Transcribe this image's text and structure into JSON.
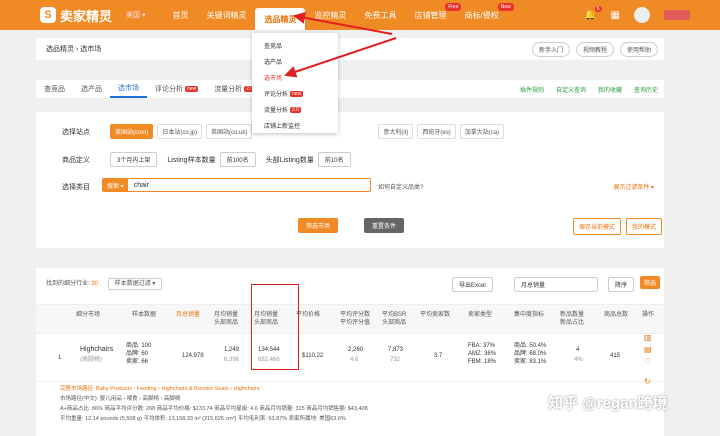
{
  "brand": "卖家精灵",
  "site_selector": "美国 ▾",
  "nav": [
    {
      "label": "首页"
    },
    {
      "label": "关键词精灵"
    },
    {
      "label": "选品精灵"
    },
    {
      "label": "监控精灵"
    },
    {
      "label": "免费工具"
    },
    {
      "label": "店铺管理",
      "badge": "Free"
    },
    {
      "label": "商标/侵权",
      "badge": "New"
    }
  ],
  "notif_count": "6",
  "breadcrumb": "选品精灵 › 选市场",
  "crumb_buttons": [
    "新手入门",
    "视频教程",
    "使用帮助"
  ],
  "dropdown": [
    {
      "label": "查竞品"
    },
    {
      "label": "选产品"
    },
    {
      "label": "选市场"
    },
    {
      "label": "评论分析",
      "badge": "new"
    },
    {
      "label": "流量分析",
      "badge": "2.0"
    },
    {
      "label": "店铺上新监控"
    }
  ],
  "tabs": [
    {
      "label": "查竞品"
    },
    {
      "label": "选产品"
    },
    {
      "label": "选市场"
    },
    {
      "label": "评论分析",
      "badge": "new"
    },
    {
      "label": "流量分析",
      "badge": "2.0"
    }
  ],
  "tab_links": [
    "插件规则",
    "自定义查询",
    "我的收藏",
    "查询历史"
  ],
  "filters": {
    "site_label": "选择站点",
    "sites": [
      "美国站(com)",
      "日本站(co.jp)",
      "英国站(co.uk)",
      "意大利(it)",
      "西班牙(es)",
      "加拿大站(ca)"
    ],
    "def_label": "商品定义",
    "period": "3个月内上架",
    "listing_label": "Listing样本数量",
    "listing_val": "前100名",
    "head_label": "头部Listing数量",
    "head_val": "前10名",
    "category_label": "选择类目",
    "search_prefix": "搜索 ▾",
    "search_value": "chair",
    "hint": "如何自定义品类?",
    "more": "展示过滤条件 ▾",
    "search_btn": "筛选市场",
    "reset_btn": "重置条件",
    "save_btn": "保存当前模式",
    "my_mode_btn": "我的模式"
  },
  "results": {
    "prefix": "找到的细分行业:",
    "count": "30",
    "sample": "样本数据过滤 ▾",
    "export": "导出Excel",
    "sort": "月总销量",
    "order": "降序",
    "filter_btn": "筛选"
  },
  "columns": [
    "细分市场",
    "样本数据",
    "月总销量",
    "月均销量\n头部商品",
    "月均销量\n头部商品",
    "平均价格",
    "平均评分数\n平均评分值",
    "平均BSR\n头部商品",
    "平均卖家数",
    "卖家类型",
    "集中度指标",
    "新品数量\n新品占比",
    "商品总数",
    "操作"
  ],
  "row": {
    "idx": "1",
    "name": "Highchairs",
    "name_cn": "(高脚椅)",
    "sample": "商品: 100\n品牌: 60\n卖家: 66",
    "monthly_total": "124,978",
    "avg_units": "1,249",
    "avg_units_sub": "6,396",
    "avg_rev": "134,544",
    "avg_rev_sub": "682,466",
    "avg_price": "$110.22",
    "ratings": "2,260",
    "ratings_sub": "4.6",
    "bsr": "7,873",
    "bsr_sub": "732",
    "sellers": "3.7",
    "seller_types": "FBA: 37%\nAMZ: 36%\nFBM: 18%",
    "concentration": "商品: 50.4%\n品牌: 68.0%\n卖家: 83.1%",
    "new_count": "4",
    "new_pct": "4%",
    "total": "415"
  },
  "detail_lines": [
    "完整市场路径: Baby Products › Feeding › Highchairs & Booster Seats › Highchairs",
    "市场路径(中文): 婴儿用品 › 喂食 › 高脚椅 › 高脚椅",
    "A+商品占比: 86%   商品平均评分数: 268   商品平均价格: $133.74   商品平均星级: 4.6   商品月均销量: 315   商品月均销售额: $43,408",
    "平均重量: 12.14 pounds (5,508 g)   平均体积: 13,158.33 in³ (215,626 cm³)   平均毛利率: 63.87%   卖家所属地: 美国63.6%"
  ],
  "watermark": "知乎 @regan跨境"
}
